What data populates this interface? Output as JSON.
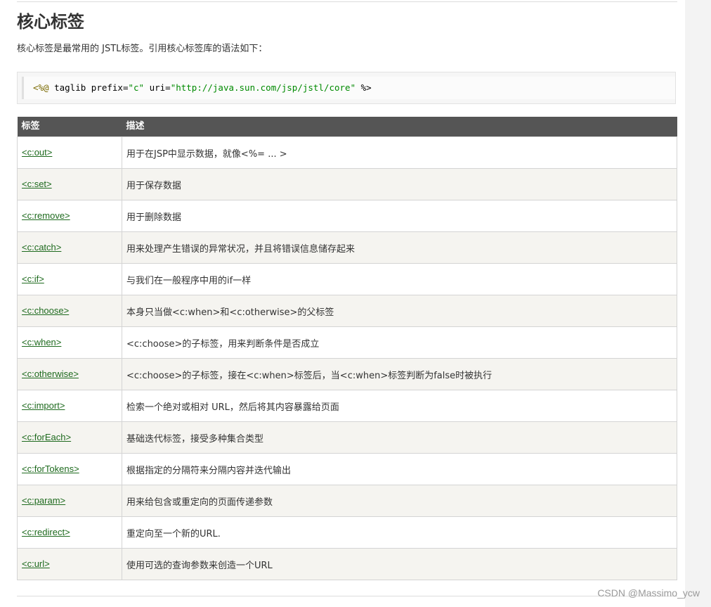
{
  "header": {
    "title": "核心标签",
    "intro": "核心标签是最常用的 JSTL标签。引用核心标签库的语法如下："
  },
  "code": {
    "directive_open": "<%@",
    "keyword": "taglib",
    "attr_prefix": "prefix=",
    "prefix_value": "\"c\"",
    "attr_uri": "uri=",
    "uri_value": "\"http://java.sun.com/jsp/jstl/core\"",
    "directive_close": "%>"
  },
  "table": {
    "headers": [
      "标签",
      "描述"
    ],
    "rows": [
      {
        "tag": "<c:out>",
        "desc": "用于在JSP中显示数据，就像<%= ... >"
      },
      {
        "tag": "<c:set>",
        "desc": "用于保存数据"
      },
      {
        "tag": "<c:remove>",
        "desc": "用于删除数据"
      },
      {
        "tag": "<c:catch>",
        "desc": "用来处理产生错误的异常状况，并且将错误信息储存起来"
      },
      {
        "tag": "<c:if>",
        "desc": "与我们在一般程序中用的if一样"
      },
      {
        "tag": "<c:choose>",
        "desc": "本身只当做<c:when>和<c:otherwise>的父标签"
      },
      {
        "tag": "<c:when>",
        "desc": "<c:choose>的子标签，用来判断条件是否成立"
      },
      {
        "tag": "<c:otherwise>",
        "desc": "<c:choose>的子标签，接在<c:when>标签后，当<c:when>标签判断为false时被执行"
      },
      {
        "tag": "<c:import>",
        "desc": "检索一个绝对或相对 URL，然后将其内容暴露给页面"
      },
      {
        "tag": "<c:forEach>",
        "desc": "基础迭代标签，接受多种集合类型"
      },
      {
        "tag": "<c:forTokens>",
        "desc": "根据指定的分隔符来分隔内容并迭代输出"
      },
      {
        "tag": "<c:param>",
        "desc": "用来给包含或重定向的页面传递参数"
      },
      {
        "tag": "<c:redirect>",
        "desc": "重定向至一个新的URL."
      },
      {
        "tag": "<c:url>",
        "desc": "使用可选的查询参数来创造一个URL"
      }
    ]
  },
  "watermark": "CSDN @Massimo_ycw",
  "colors": {
    "header_bg": "#555555",
    "link": "#1e6a1e",
    "alt_row": "#f5f4f0"
  }
}
